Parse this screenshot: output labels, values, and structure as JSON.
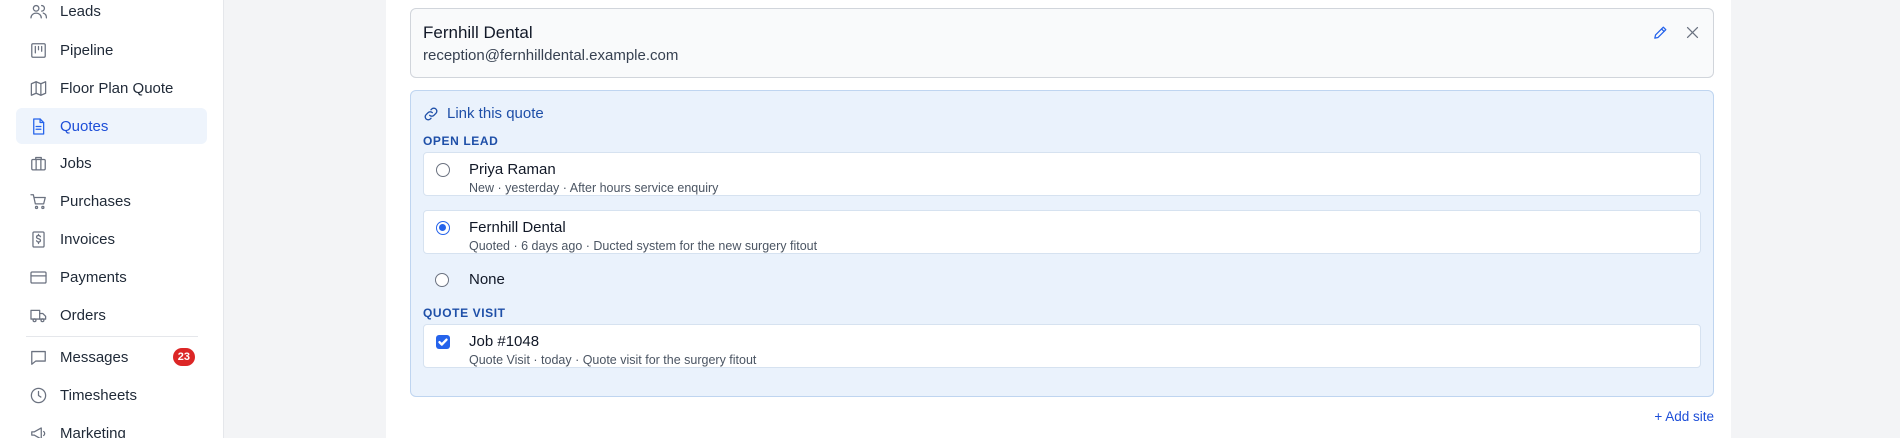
{
  "sidebar": {
    "items": [
      {
        "label": "Leads",
        "icon": "users-icon"
      },
      {
        "label": "Pipeline",
        "icon": "kanban-icon"
      },
      {
        "label": "Floor Plan Quote",
        "icon": "map-icon"
      },
      {
        "label": "Quotes",
        "icon": "document-icon",
        "active": true
      },
      {
        "label": "Jobs",
        "icon": "briefcase-icon"
      },
      {
        "label": "Purchases",
        "icon": "cart-icon"
      },
      {
        "label": "Invoices",
        "icon": "dollar-invoice-icon"
      },
      {
        "label": "Payments",
        "icon": "credit-card-icon"
      },
      {
        "label": "Orders",
        "icon": "truck-icon"
      },
      {
        "label": "Messages",
        "icon": "message-icon",
        "badge": "23"
      },
      {
        "label": "Timesheets",
        "icon": "clock-icon"
      },
      {
        "label": "Marketing",
        "icon": "megaphone-icon"
      }
    ]
  },
  "contact": {
    "name": "Fernhill Dental",
    "email": "reception@fernhilldental.example.com"
  },
  "link": {
    "header": "Link this quote",
    "open_lead_label": "OPEN LEAD",
    "leads": [
      {
        "title": "Priya Raman",
        "subtitle": "New · yesterday · After hours service enquiry",
        "selected": false
      },
      {
        "title": "Fernhill Dental",
        "subtitle": "Quoted · 6 days ago · Ducted system for the new surgery fitout",
        "selected": true
      }
    ],
    "none_label": "None",
    "quote_visit_label": "QUOTE VISIT",
    "visit": {
      "title": "Job #1048",
      "subtitle": "Quote Visit · today · Quote visit for the surgery fitout",
      "checked": true
    }
  },
  "add_site_label": "+ Add site",
  "colors": {
    "accent": "#2563eb",
    "badge": "#dc2626",
    "link_bg": "#eaf2fc"
  }
}
